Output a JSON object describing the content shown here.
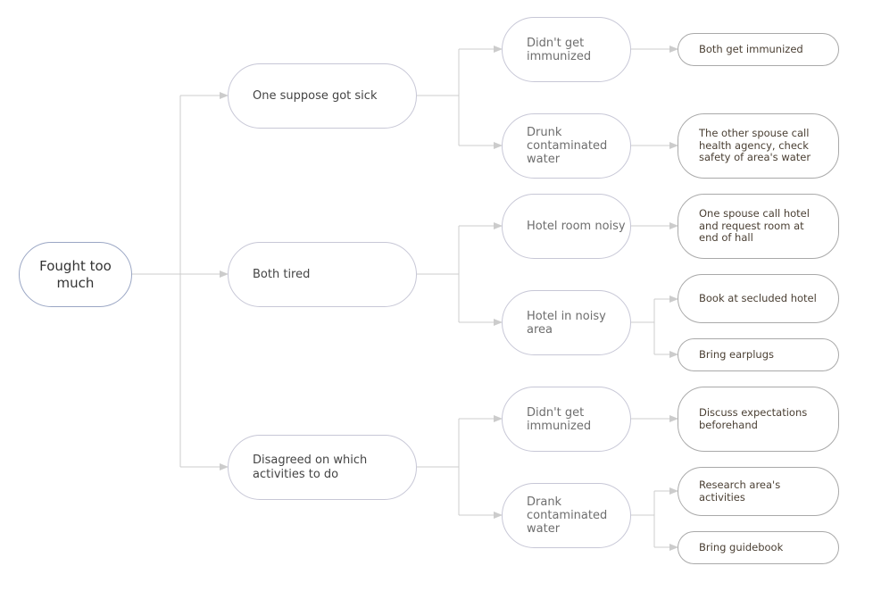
{
  "diagram": {
    "type": "cause-solution tree",
    "colors": {
      "connector": "#cccccc",
      "root_border": "#9aa6c4",
      "node_border": "#c7c7d6",
      "leaf_border": "#a9a9a9",
      "root_text": "#333333",
      "level1_text": "#444444",
      "level2_text": "#6e6e6e",
      "leaf_text": "#4a3f33"
    },
    "root": {
      "label": "Fought too\nmuch"
    },
    "causes": [
      {
        "label": "One suppose got sick",
        "subcauses": [
          {
            "label": "Didn't get\nimmunized",
            "solutions": [
              "Both get immunized"
            ]
          },
          {
            "label": "Drunk\ncontaminated\nwater",
            "solutions": [
              "The other spouse call\nhealth agency, check\nsafety of area's water"
            ]
          }
        ]
      },
      {
        "label": "Both tired",
        "subcauses": [
          {
            "label": "Hotel room noisy",
            "solutions": [
              "One spouse call hotel\nand request room at\nend of hall"
            ]
          },
          {
            "label": "Hotel in noisy\narea",
            "solutions": [
              "Book at secluded hotel",
              "Bring earplugs"
            ]
          }
        ]
      },
      {
        "label": "Disagreed on which\nactivities to do",
        "subcauses": [
          {
            "label": "Didn't get\nimmunized",
            "solutions": [
              "Discuss expectations\nbeforehand"
            ]
          },
          {
            "label": "Drank\ncontaminated\nwater",
            "solutions": [
              "Research area's\nactivities",
              "Bring guidebook"
            ]
          }
        ]
      }
    ]
  }
}
